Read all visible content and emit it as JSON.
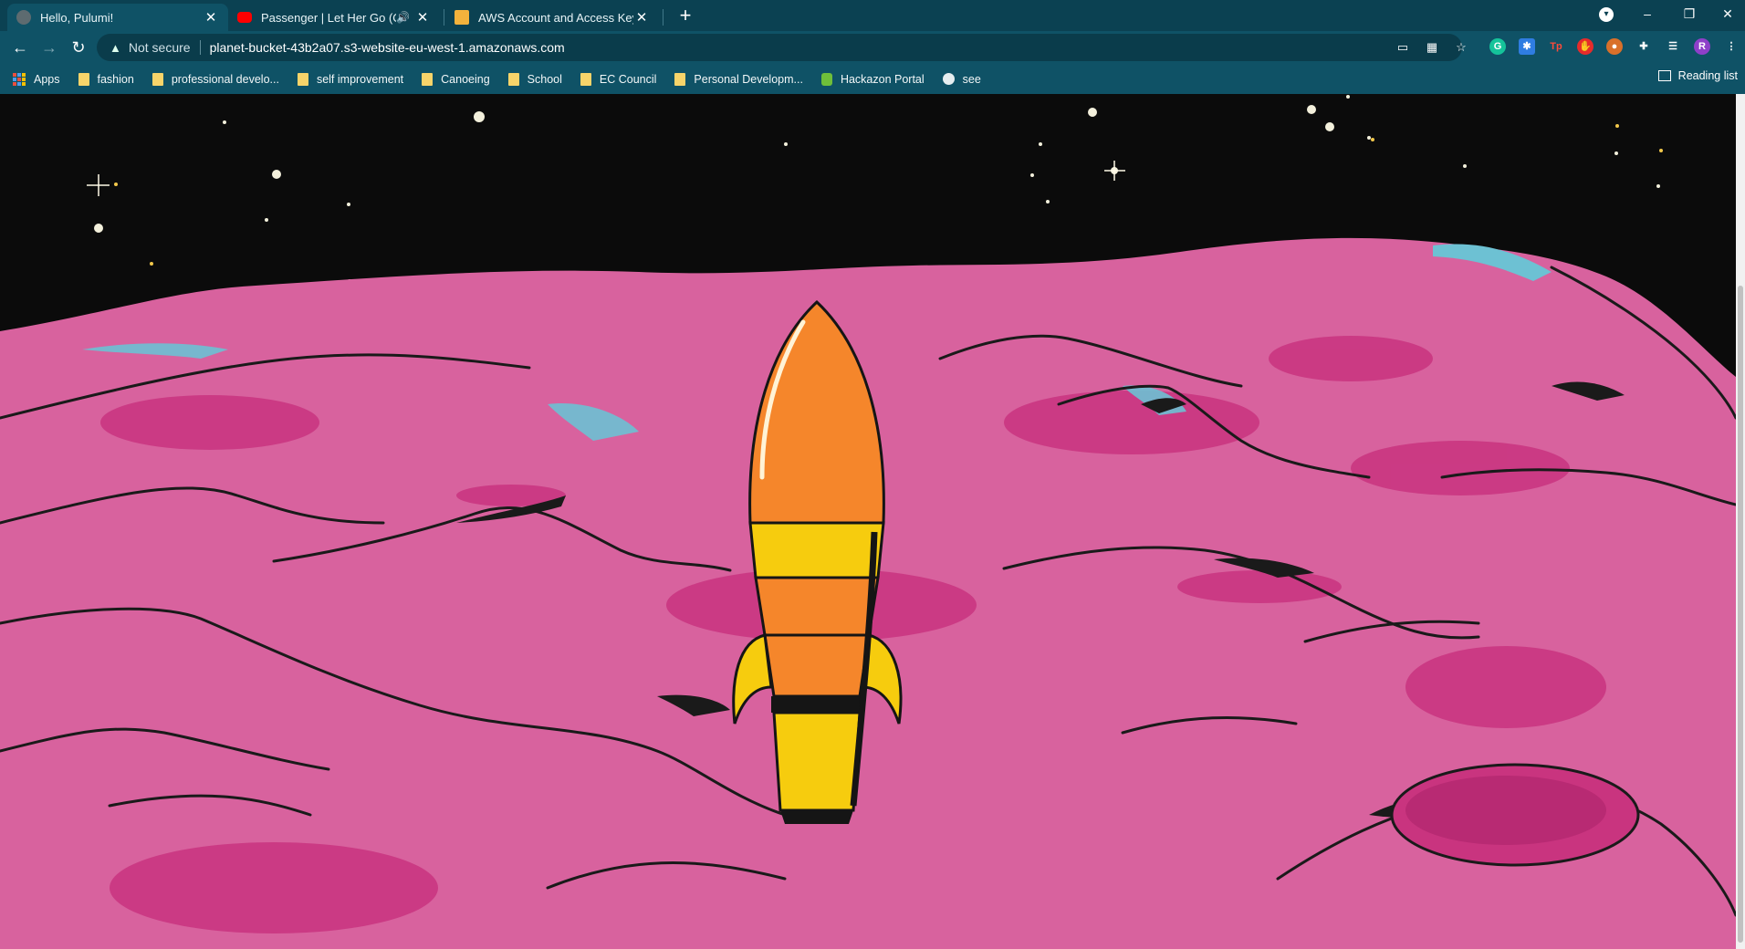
{
  "browser": {
    "tabs": [
      {
        "title": "Hello, Pulumi!",
        "active": true,
        "favicon": "globe-icon"
      },
      {
        "title": "Passenger | Let Her Go (Offic",
        "active": false,
        "favicon": "youtube-icon",
        "audio": "speaker-icon"
      },
      {
        "title": "AWS Account and Access Keys - ",
        "active": false,
        "favicon": "aws-icon"
      }
    ],
    "new_tab_symbol": "+",
    "window_controls": {
      "minimize": "–",
      "restore": "❐",
      "close": "✕"
    },
    "address_bar": {
      "security_label": "Not secure",
      "url": "planet-bucket-43b2a07.s3-website-eu-west-1.amazonaws.com"
    },
    "profile_initial": "R",
    "bookmarks": [
      {
        "label": "Apps",
        "icon": "apps-grid-icon"
      },
      {
        "label": "fashion",
        "icon": "folder-icon"
      },
      {
        "label": "professional develo...",
        "icon": "folder-icon"
      },
      {
        "label": "self improvement",
        "icon": "folder-icon"
      },
      {
        "label": "Canoeing",
        "icon": "folder-icon"
      },
      {
        "label": "School",
        "icon": "folder-icon"
      },
      {
        "label": "EC Council",
        "icon": "folder-icon"
      },
      {
        "label": "Personal Developm...",
        "icon": "folder-icon"
      },
      {
        "label": "Hackazon Portal",
        "icon": "hackazon-icon"
      },
      {
        "label": "see",
        "icon": "globe-icon"
      }
    ],
    "reading_list_label": "Reading list"
  },
  "colors": {
    "tabstrip": "#0b4152",
    "toolbar": "#0f5266",
    "sky": "#0b0b0b",
    "planet_pink": "#d8629e",
    "rocket_orange": "#f5862b",
    "rocket_yellow": "#f6cc0e"
  }
}
